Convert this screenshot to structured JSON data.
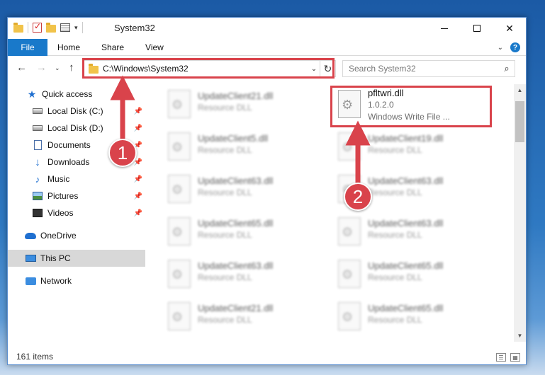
{
  "window": {
    "title": "System32"
  },
  "ribbon": {
    "file": "File",
    "tabs": [
      "Home",
      "Share",
      "View"
    ]
  },
  "address": {
    "path": "C:\\Windows\\System32"
  },
  "search": {
    "placeholder": "Search System32"
  },
  "sidebar": {
    "items": [
      {
        "label": "Quick access",
        "icon": "star-icon"
      },
      {
        "label": "Local Disk (C:)",
        "icon": "drive-icon",
        "pinned": true
      },
      {
        "label": "Local Disk (D:)",
        "icon": "drive-icon",
        "pinned": true
      },
      {
        "label": "Documents",
        "icon": "document-icon",
        "pinned": true
      },
      {
        "label": "Downloads",
        "icon": "download-icon",
        "pinned": true
      },
      {
        "label": "Music",
        "icon": "music-icon",
        "pinned": true
      },
      {
        "label": "Pictures",
        "icon": "pictures-icon",
        "pinned": true
      },
      {
        "label": "Videos",
        "icon": "videos-icon",
        "pinned": true
      },
      {
        "label": "OneDrive",
        "icon": "cloud-icon"
      },
      {
        "label": "This PC",
        "icon": "computer-icon",
        "selected": true
      },
      {
        "label": "Network",
        "icon": "network-icon"
      }
    ]
  },
  "files": {
    "highlighted": {
      "name": "pfltwri.dll",
      "version": "1.0.2.0",
      "desc": "Windows Write File ..."
    },
    "left": [
      {
        "name": "UpdateClient21.dll",
        "type": "Resource DLL"
      },
      {
        "name": "UpdateClient5.dll",
        "type": "Resource DLL"
      },
      {
        "name": "UpdateClient63.dll",
        "type": "Resource DLL"
      },
      {
        "name": "UpdateClient65.dll",
        "type": "Resource DLL"
      },
      {
        "name": "UpdateClient63.dll",
        "type": "Resource DLL"
      },
      {
        "name": "UpdateClient21.dll",
        "type": "Resource DLL"
      }
    ],
    "right": [
      {
        "name": "UpdateClient19.dll",
        "type": "Resource DLL"
      },
      {
        "name": "UpdateClient63.dll",
        "type": "Resource DLL"
      },
      {
        "name": "UpdateClient63.dll",
        "type": "Resource DLL"
      },
      {
        "name": "UpdateClient65.dll",
        "type": "Resource DLL"
      },
      {
        "name": "UpdateClient65.dll",
        "type": "Resource DLL"
      }
    ]
  },
  "status": {
    "items": "161 items"
  },
  "annotations": {
    "step1": "1",
    "step2": "2",
    "color": "#d9434b"
  }
}
